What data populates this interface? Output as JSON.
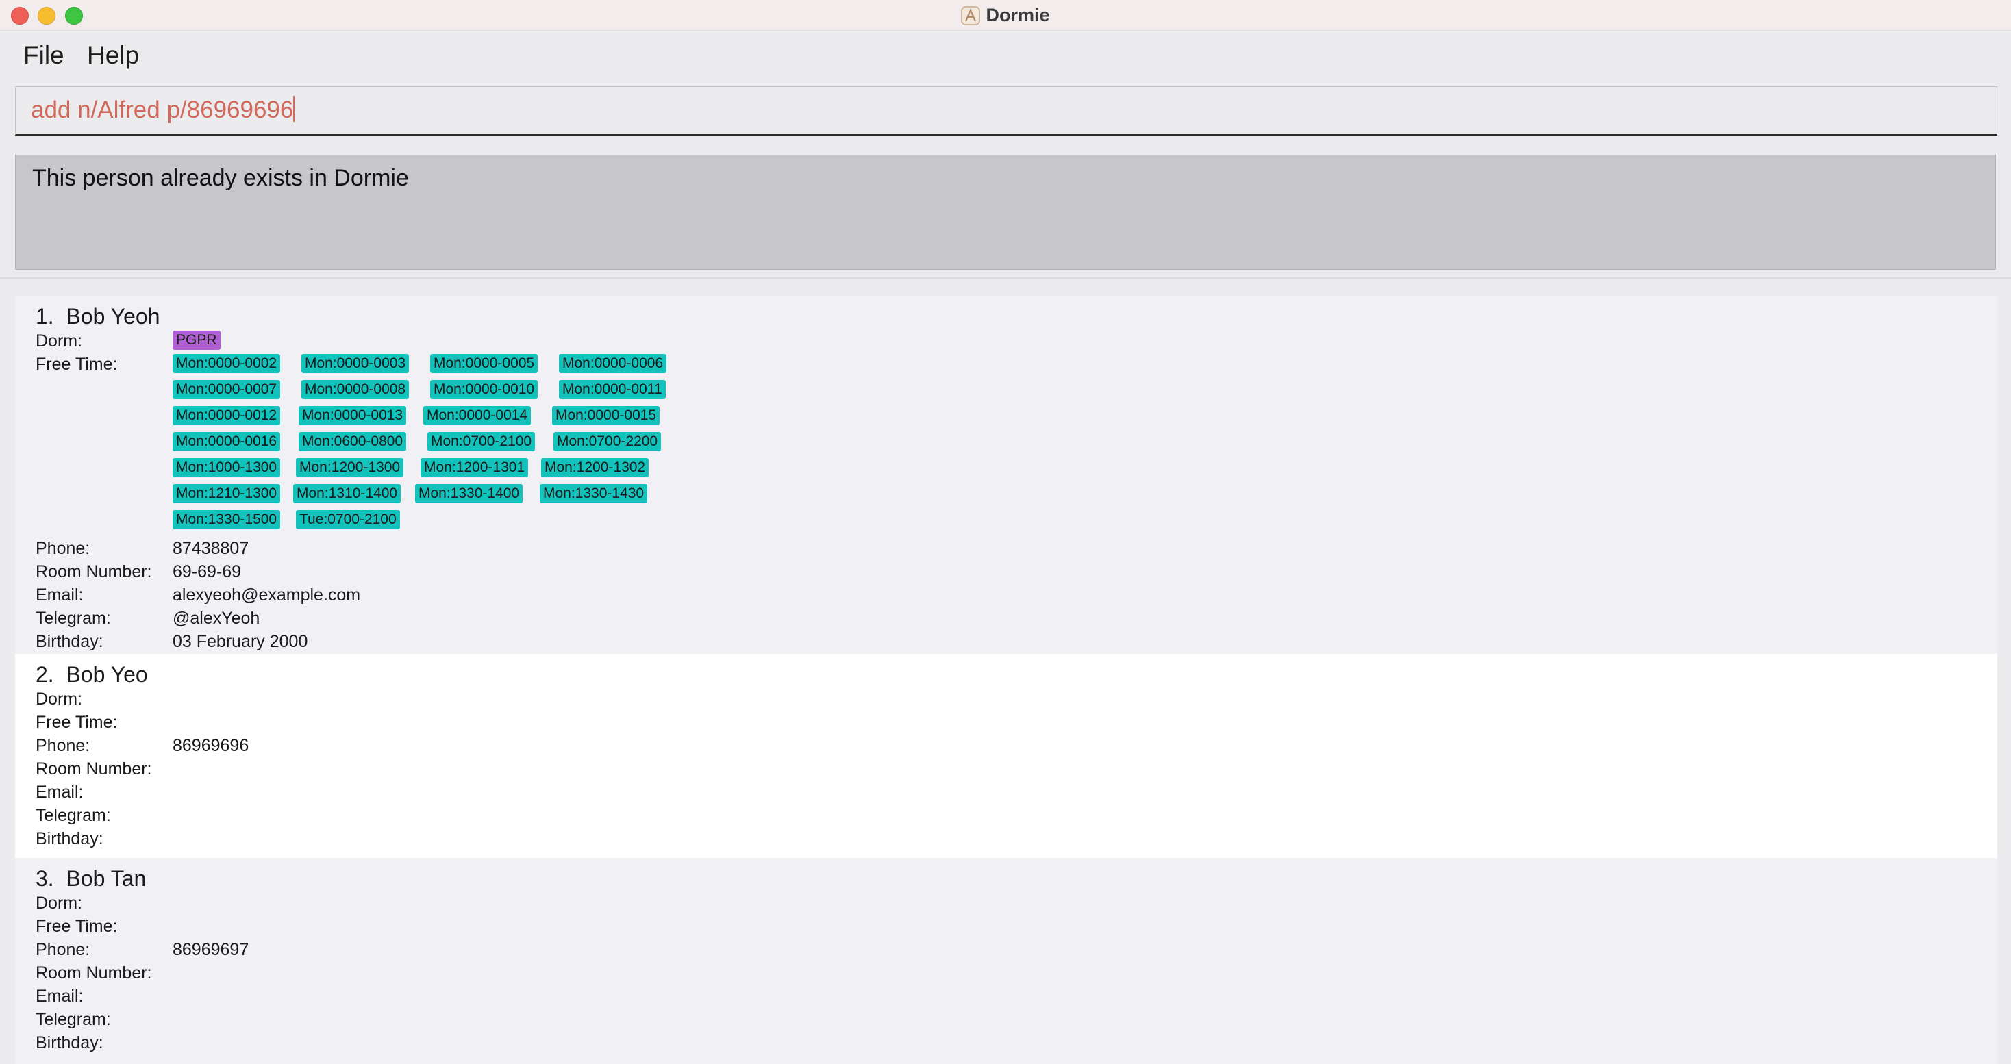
{
  "window": {
    "title": "Dormie"
  },
  "menu": {
    "items": [
      "File",
      "Help"
    ]
  },
  "command": {
    "value": "add n/Alfred p/86969696"
  },
  "result": {
    "message": "This person already exists in Dormie"
  },
  "labels": {
    "dorm": "Dorm:",
    "free_time": "Free Time:",
    "phone": "Phone:",
    "room": "Room Number:",
    "email": "Email:",
    "telegram": "Telegram:",
    "birthday": "Birthday:"
  },
  "persons": [
    {
      "index": "1.",
      "name": "Bob Yeoh",
      "dorm": "PGPR",
      "free_time": [
        [
          "Mon:0000-0002",
          "Mon:0000-0003",
          "Mon:0000-0005",
          "Mon:0000-0006"
        ],
        [
          "Mon:0000-0007",
          "Mon:0000-0008",
          "Mon:0000-0010",
          "Mon:0000-0011"
        ],
        [
          "Mon:0000-0012",
          "Mon:0000-0013",
          "Mon:0000-0014",
          "Mon:0000-0015"
        ],
        [
          "Mon:0000-0016",
          "Mon:0600-0800",
          "Mon:0700-2100",
          "Mon:0700-2200"
        ],
        [
          "Mon:1000-1300",
          "Mon:1200-1300",
          "Mon:1200-1301",
          "Mon:1200-1302"
        ],
        [
          "Mon:1210-1300",
          "Mon:1310-1400",
          "Mon:1330-1400",
          "Mon:1330-1430"
        ],
        [
          "Mon:1330-1500",
          "Tue:0700-2100"
        ]
      ],
      "phone": "87438807",
      "room": "69-69-69",
      "email": "alexyeoh@example.com",
      "telegram": "@alexYeoh",
      "birthday": "03 February 2000"
    },
    {
      "index": "2.",
      "name": "Bob Yeo",
      "dorm": "",
      "free_time": [],
      "phone": "86969696",
      "room": "",
      "email": "",
      "telegram": "",
      "birthday": ""
    },
    {
      "index": "3.",
      "name": "Bob Tan",
      "dorm": "",
      "free_time": [],
      "phone": "86969697",
      "room": "",
      "email": "",
      "telegram": "",
      "birthday": ""
    }
  ],
  "colors": {
    "dorm_tag": "#b15fd4",
    "free_time_tag": "#14c2bc",
    "command_text": "#d2695a"
  }
}
